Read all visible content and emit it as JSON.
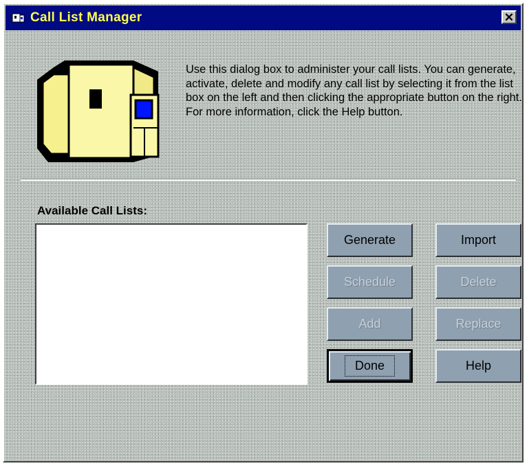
{
  "window": {
    "title": "Call List Manager",
    "close_label": "✕",
    "title_color": "#ffff4a",
    "titlebar_color": "#000a82"
  },
  "header": {
    "graphic": "computer-tower-icon",
    "description": "Use this dialog box to administer your call lists. You can generate, activate, delete and modify any call list by selecting it from the list box on the left and then clicking the appropriate button on the right. For more information, click the Help button."
  },
  "call_lists": {
    "label": "Available Call Lists:",
    "items": []
  },
  "buttons": {
    "generate": {
      "label": "Generate",
      "enabled": true
    },
    "import": {
      "label": "Import",
      "enabled": true
    },
    "schedule": {
      "label": "Schedule",
      "enabled": false
    },
    "delete": {
      "label": "Delete",
      "enabled": false
    },
    "add": {
      "label": "Add",
      "enabled": false
    },
    "replace": {
      "label": "Replace",
      "enabled": false
    },
    "done": {
      "label": "Done",
      "enabled": true,
      "default": true
    },
    "help": {
      "label": "Help",
      "enabled": true
    }
  }
}
